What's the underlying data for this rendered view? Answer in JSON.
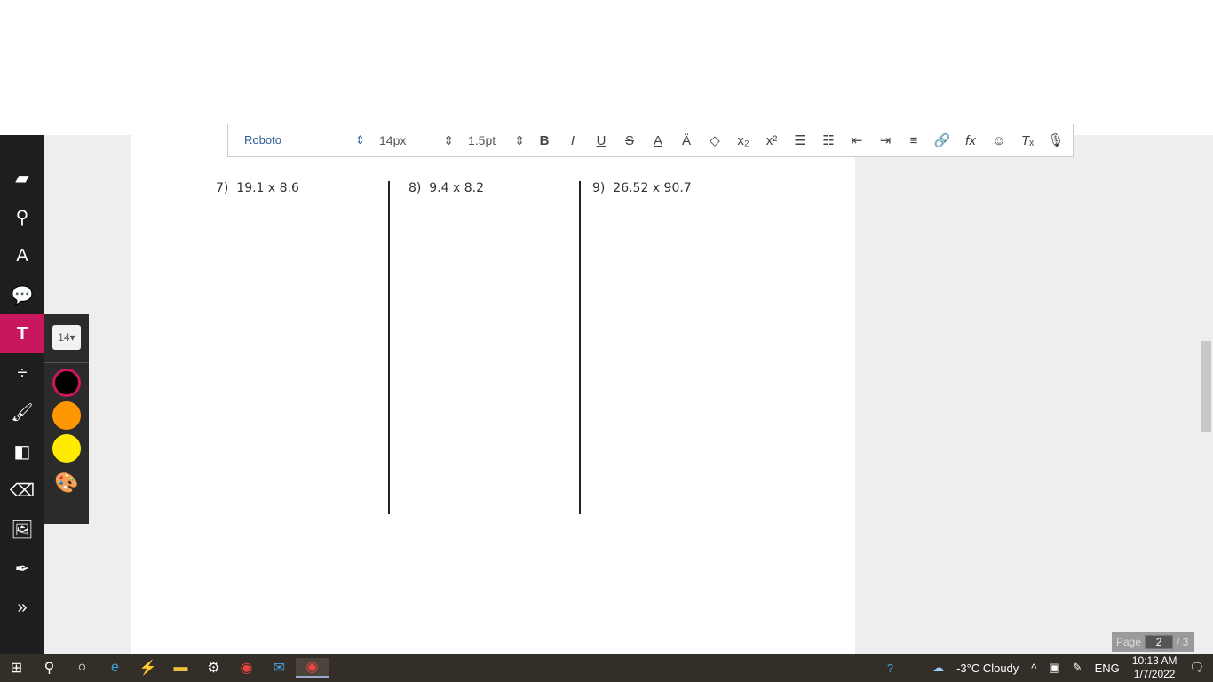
{
  "toolbar": {
    "font": "Roboto",
    "size": "14px",
    "line_height": "1.5pt",
    "buttons": [
      "bold",
      "italic",
      "underline",
      "strikethrough",
      "font-color",
      "highlight",
      "fill",
      "subscript",
      "superscript",
      "ordered-list",
      "bullet-list",
      "outdent",
      "indent",
      "align",
      "link",
      "formula",
      "emoji",
      "clear-format",
      "microphone"
    ]
  },
  "problems": [
    {
      "num": "7)",
      "expr": "19.1 x 8.6"
    },
    {
      "num": "8)",
      "expr": "9.4 x 8.2"
    },
    {
      "num": "9)",
      "expr": "26.52 x 90.7"
    }
  ],
  "text_tool": {
    "font_size": "14",
    "colors": [
      "#000000",
      "#ff9800",
      "#ffeb00"
    ]
  },
  "pager": {
    "label": "Page",
    "current": "2",
    "total": "/ 3"
  },
  "taskbar": {
    "weather": "-3°C  Cloudy",
    "lang": "ENG",
    "time": "10:13 AM",
    "date": "1/7/2022"
  }
}
